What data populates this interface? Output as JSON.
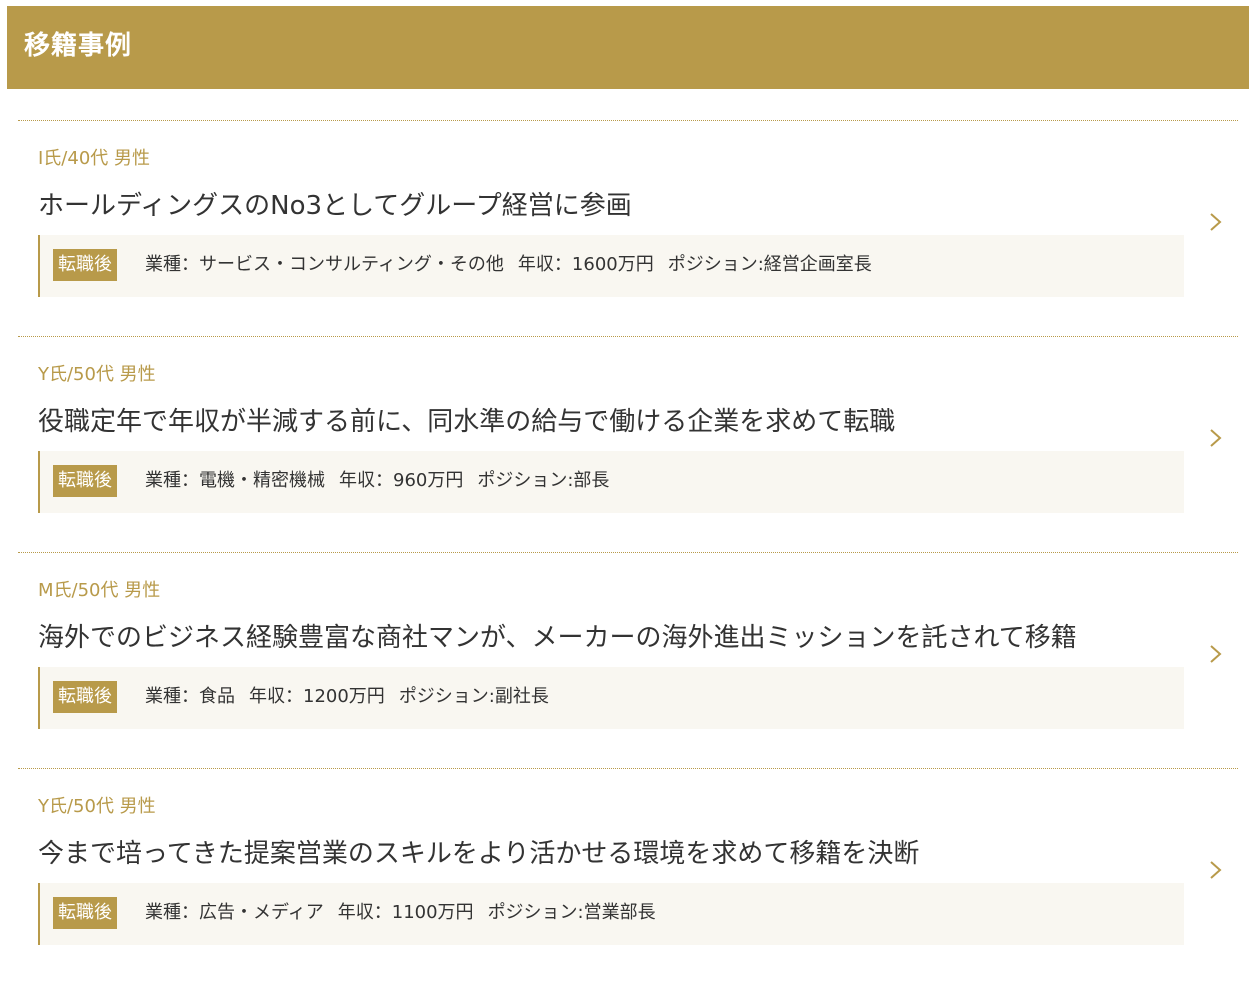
{
  "section": {
    "title": "移籍事例"
  },
  "cases": [
    {
      "person": "I氏/40代 男性",
      "title": "ホールディングスのNo3としてグループ経営に参画",
      "after_label": "転職後",
      "industry": "業種：サービス・コンサルティング・その他",
      "income": "年収：1600万円",
      "position": "ポジション:経営企画室長"
    },
    {
      "person": "Y氏/50代 男性",
      "title": "役職定年で年収が半減する前に、同水準の給与で働ける企業を求めて転職",
      "after_label": "転職後",
      "industry": "業種：電機・精密機械",
      "income": "年収：960万円",
      "position": "ポジション:部長"
    },
    {
      "person": "M氏/50代 男性",
      "title": "海外でのビジネス経験豊富な商社マンが、メーカーの海外進出ミッションを託されて移籍",
      "after_label": "転職後",
      "industry": "業種：食品",
      "income": "年収：1200万円",
      "position": "ポジション:副社長"
    },
    {
      "person": "Y氏/50代 男性",
      "title": "今まで培ってきた提案営業のスキルをより活かせる環境を求めて移籍を決断",
      "after_label": "転職後",
      "industry": "業種：広告・メディア",
      "income": "年収：1100万円",
      "position": "ポジション:営業部長"
    }
  ],
  "colors": {
    "accent": "#b89a4a",
    "detail_bg": "#f9f7f1",
    "text": "#333333"
  },
  "icons": {
    "chevron": "chevron-right-icon"
  }
}
